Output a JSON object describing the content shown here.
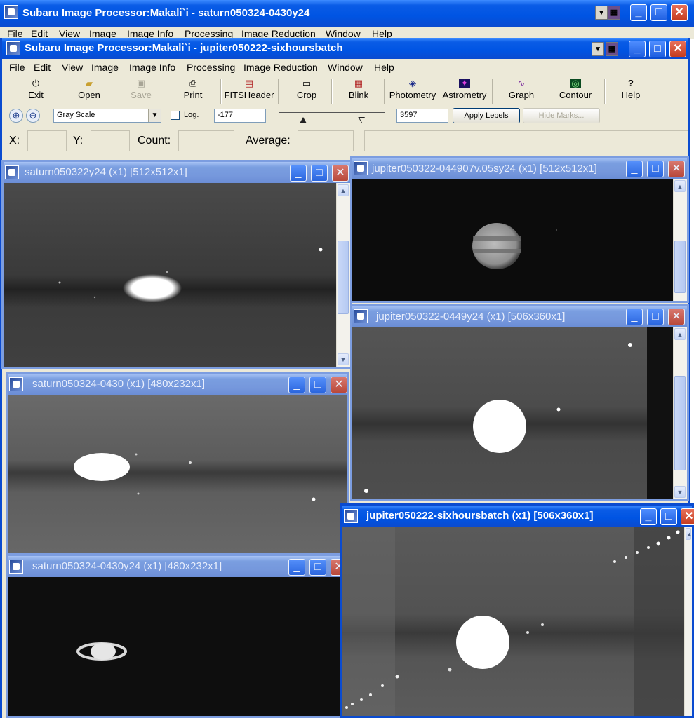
{
  "back_window": {
    "title": "Subaru Image Processor:Makali`i - saturn050324-0430y24",
    "menu": [
      "File",
      "Edit",
      "View",
      "Image",
      "Image Info",
      "Processing",
      "Image Reduction",
      "Window",
      "Help"
    ]
  },
  "main_window": {
    "title": "Subaru Image Processor:Makali`i - jupiter050222-sixhoursbatch",
    "menu": [
      "File",
      "Edit",
      "View",
      "Image",
      "Image Info",
      "Processing",
      "Image Reduction",
      "Window",
      "Help"
    ],
    "toolbar": [
      {
        "label": "Exit",
        "icon": "power-icon",
        "glyph": "⏻",
        "enabled": true
      },
      {
        "label": "Open",
        "icon": "folder-open-icon",
        "glyph": "📂",
        "enabled": true
      },
      {
        "label": "Save",
        "icon": "floppy-icon",
        "glyph": "💾",
        "enabled": false
      },
      {
        "label": "Print",
        "icon": "printer-icon",
        "glyph": "⎙",
        "enabled": true
      },
      {
        "label": "FITSHeader",
        "icon": "fits-header-icon",
        "glyph": "▤",
        "enabled": true
      },
      {
        "label": "Crop",
        "icon": "crop-icon",
        "glyph": "▭",
        "enabled": true
      },
      {
        "label": "Blink",
        "icon": "blink-icon",
        "glyph": "▦",
        "enabled": true
      },
      {
        "label": "Photometry",
        "icon": "photometry-icon",
        "glyph": "◈",
        "enabled": true
      },
      {
        "label": "Astrometry",
        "icon": "astrometry-icon",
        "glyph": "✦",
        "enabled": true
      },
      {
        "label": "Graph",
        "icon": "graph-icon",
        "glyph": "∿",
        "enabled": true
      },
      {
        "label": "Contour",
        "icon": "contour-icon",
        "glyph": "◎",
        "enabled": true
      },
      {
        "label": "Help",
        "icon": "help-icon",
        "glyph": "?",
        "enabled": true
      }
    ],
    "controls": {
      "color_scale": "Gray Scale",
      "log_label": "Log.",
      "log_checked": false,
      "min_value": "-177",
      "max_value": "3597",
      "apply_button": "Apply Lebels",
      "hide_marks_button": "Hide Marks..."
    },
    "status": {
      "x_label": "X:",
      "y_label": "Y:",
      "count_label": "Count:",
      "average_label": "Average:",
      "x_value": "",
      "y_value": "",
      "count_value": "",
      "average_value": ""
    }
  },
  "image_windows": [
    {
      "title": "saturn050322y24 (x1) [512x512x1]",
      "active": false
    },
    {
      "title": "jupiter050322-044907v.05sy24 (x1) [512x512x1]",
      "active": false
    },
    {
      "title": "jupiter050322-0449y24 (x1) [506x360x1]",
      "active": false
    },
    {
      "title": "saturn050324-0430 (x1) [480x232x1]",
      "active": false
    },
    {
      "title": "saturn050324-0430y24 (x1) [480x232x1]",
      "active": false
    },
    {
      "title": "jupiter050222-sixhoursbatch (x1) [506x360x1]",
      "active": true
    }
  ],
  "colors": {
    "titlebar_active": "#0054e3",
    "titlebar_inactive": "#7a9ee0",
    "window_face": "#ece9d8",
    "close_button": "#c53c1f"
  }
}
